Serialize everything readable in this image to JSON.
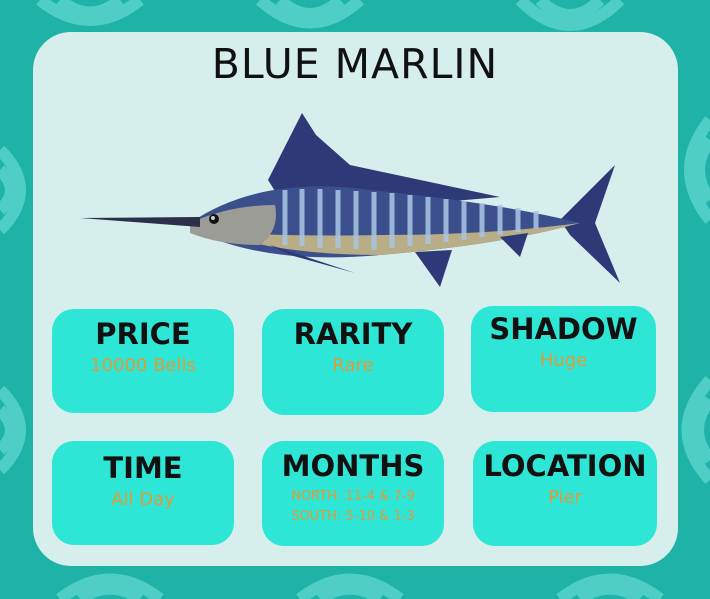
{
  "title": "BLUE MARLIN",
  "fish": {
    "icon": "blue-marlin-fish"
  },
  "stats": [
    {
      "label": "PRICE",
      "value": "10000 Bells"
    },
    {
      "label": "RARITY",
      "value": "Rare"
    },
    {
      "label": "SHADOW",
      "value": "Huge"
    },
    {
      "label": "TIME",
      "value": "All Day"
    },
    {
      "label": "MONTHS",
      "north": "NORTH: 11-4 & 7-9",
      "south": "SOUTH: 5-10 & 1-3"
    },
    {
      "label": "LOCATION",
      "value": "Pier"
    }
  ],
  "colors": {
    "background": "#1fb3a8",
    "card": "#d6eeec",
    "tile": "#2ee6d6",
    "value_text": "#e09a3c"
  }
}
